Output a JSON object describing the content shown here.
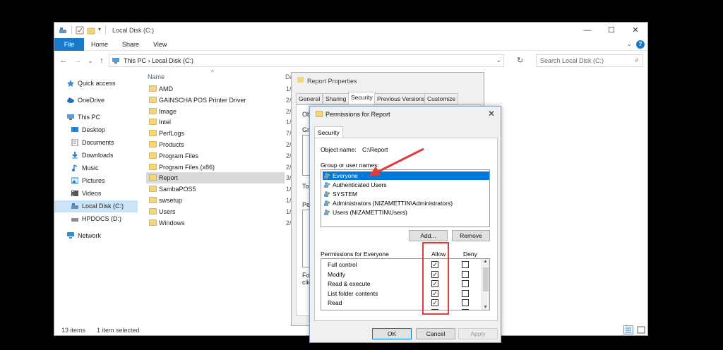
{
  "explorer": {
    "title": "Local Disk (C:)",
    "window_buttons": {
      "minimize": "—",
      "maximize": "☐",
      "close": "✕"
    },
    "ribbon": {
      "file": "File",
      "tabs": [
        "Home",
        "Share",
        "View"
      ],
      "help": "?",
      "expand": "⌄"
    },
    "nav": {
      "back": "←",
      "forward": "→",
      "recent": "⌄",
      "up": "↑",
      "refresh": "↻"
    },
    "address": {
      "crumbs": "This PC  ›  Local Disk (C:)",
      "dropdown": "⌄"
    },
    "search": {
      "placeholder": "Search Local Disk (C:)",
      "icon": "⌕"
    },
    "sidebar": [
      {
        "label": "Quick access",
        "icon": "star-icon"
      },
      {
        "label": "OneDrive",
        "icon": "cloud-icon"
      },
      {
        "label": "This PC",
        "icon": "computer-icon"
      },
      {
        "label": "Desktop",
        "icon": "desktop-icon"
      },
      {
        "label": "Documents",
        "icon": "documents-icon"
      },
      {
        "label": "Downloads",
        "icon": "downloads-icon"
      },
      {
        "label": "Music",
        "icon": "music-icon"
      },
      {
        "label": "Pictures",
        "icon": "pictures-icon"
      },
      {
        "label": "Videos",
        "icon": "videos-icon"
      },
      {
        "label": "Local Disk (C:)",
        "icon": "drive-icon"
      },
      {
        "label": "HPDOCS (D:)",
        "icon": "drive-icon"
      },
      {
        "label": "Network",
        "icon": "network-icon"
      }
    ],
    "columns": {
      "name": "Name",
      "date": "Da",
      "sort_caret": "^"
    },
    "files": [
      {
        "name": "AMD",
        "date": "1/"
      },
      {
        "name": "GAINSCHA POS Printer Driver",
        "date": "2/"
      },
      {
        "name": "Image",
        "date": "2/"
      },
      {
        "name": "Intel",
        "date": "1/"
      },
      {
        "name": "PerfLogs",
        "date": "7/"
      },
      {
        "name": "Products",
        "date": "2/"
      },
      {
        "name": "Program Files",
        "date": "2/"
      },
      {
        "name": "Program Files (x86)",
        "date": "2/"
      },
      {
        "name": "Report",
        "date": "3/"
      },
      {
        "name": "SambaPOS5",
        "date": "1/"
      },
      {
        "name": "swsetup",
        "date": "1/"
      },
      {
        "name": "Users",
        "date": "1/"
      },
      {
        "name": "Windows",
        "date": "2/"
      }
    ],
    "status": {
      "count": "13 items",
      "selected": "1 item selected"
    }
  },
  "properties": {
    "title": "Report Properties",
    "tabs": [
      "General",
      "Sharing",
      "Security",
      "Previous Versions",
      "Customize"
    ],
    "partial": {
      "obj": "Ob",
      "gro": "Gro",
      "to": "To",
      "pe": "Pe",
      "fo": "Fo",
      "cli": "clic"
    }
  },
  "permissions": {
    "title": "Permissions for Report",
    "close": "✕",
    "tab": "Security",
    "object_label": "Object name:",
    "object_value": "C:\\Report",
    "group_label": "Group or user names:",
    "users": [
      "Everyone",
      "Authenticated Users",
      "SYSTEM",
      "Administrators (NIZAMETTIN\\Administrators)",
      "Users (NIZAMETTIN\\Users)"
    ],
    "add_label": "Add...",
    "remove_label": "Remove",
    "perm_for_label": "Permissions for Everyone",
    "allow_head": "Allow",
    "deny_head": "Deny",
    "rows": [
      {
        "label": "Full control",
        "allow": true,
        "deny": false
      },
      {
        "label": "Modify",
        "allow": true,
        "deny": false
      },
      {
        "label": "Read & execute",
        "allow": true,
        "deny": false
      },
      {
        "label": "List folder contents",
        "allow": true,
        "deny": false
      },
      {
        "label": "Read",
        "allow": true,
        "deny": false
      },
      {
        "label": "",
        "allow": true,
        "deny": false
      }
    ],
    "ok_label": "OK",
    "cancel_label": "Cancel",
    "apply_label": "Apply",
    "check_mark": "✓"
  },
  "colors": {
    "accent": "#1979ca",
    "selection": "#0078d7",
    "annotation": "#e03c3c"
  }
}
